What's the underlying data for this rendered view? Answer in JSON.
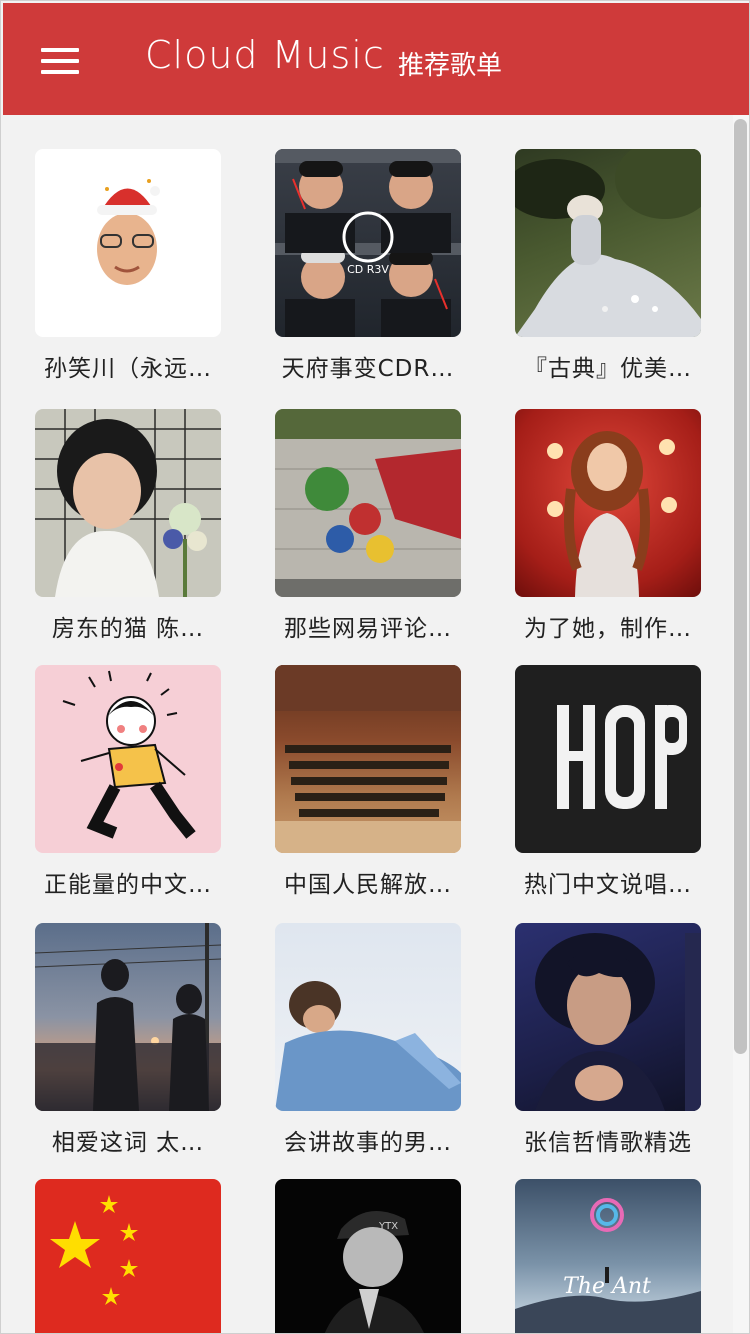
{
  "app": {
    "title": "Cloud Music",
    "subtitle": "推荐歌单",
    "accent_color": "#cf3a3a"
  },
  "playlists": [
    {
      "name": "孙笑川（永远…",
      "cover": "santa-hat-portrait"
    },
    {
      "name": "天府事变CDR…",
      "cover": "cdrev-group-photo"
    },
    {
      "name": "『古典』优美…",
      "cover": "monet-painting"
    },
    {
      "name": "房东的猫 陈…",
      "cover": "girl-with-flowers"
    },
    {
      "name": "那些网易评论…",
      "cover": "hulk-graffiti"
    },
    {
      "name": "为了她，制作…",
      "cover": "singer-red-stage"
    },
    {
      "name": "正能量的中文…",
      "cover": "dancing-girl-illustration"
    },
    {
      "name": "中国人民解放…",
      "cover": "military-band"
    },
    {
      "name": "热门中文说唱…",
      "cover": "hop-logo"
    },
    {
      "name": "相爱这词 太…",
      "cover": "couple-silhouette"
    },
    {
      "name": "会讲故事的男…",
      "cover": "man-blue-shirt"
    },
    {
      "name": "张信哲情歌精选",
      "cover": "singer-portrait"
    },
    {
      "name": "",
      "cover": "china-flag"
    },
    {
      "name": "",
      "cover": "rapper-cap"
    },
    {
      "name": "",
      "cover": "the-ant-sky",
      "cover_text": "The Ant"
    }
  ]
}
